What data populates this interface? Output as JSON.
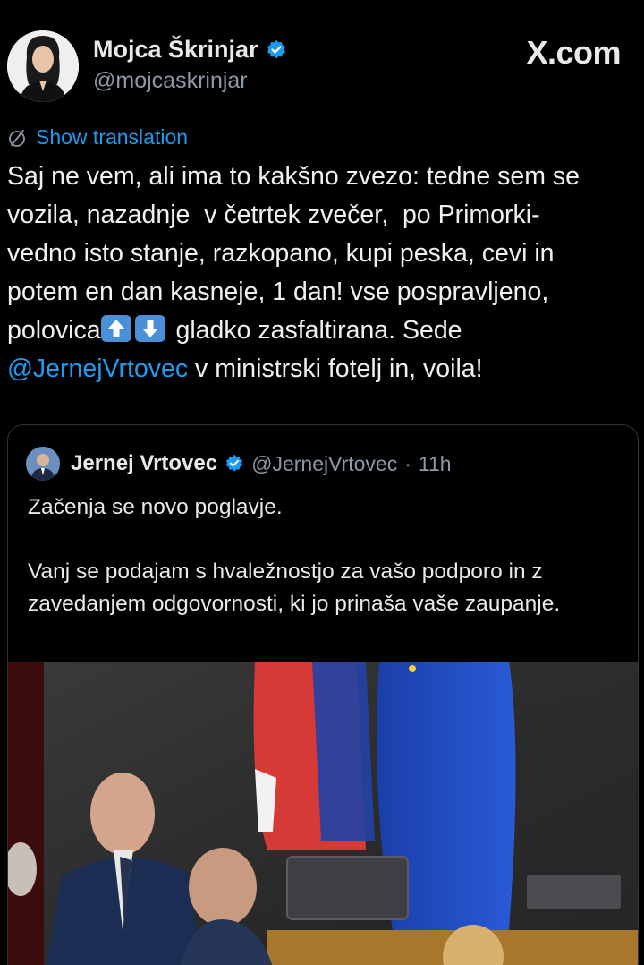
{
  "author": {
    "name": "Mojca Škrinjar",
    "handle": "@mojcaskrinjar",
    "avatar_icon": "profile-photo-woman"
  },
  "brand": {
    "label": "X.com"
  },
  "translation": {
    "label": "Show translation",
    "icon": "translate-icon"
  },
  "tweet": {
    "line1": "Saj ne vem, ali ima to kakšno zvezo: tedne sem se",
    "line2": "vozila, nazadnje  v četrtek zvečer,  po Primorki-",
    "line3": "vedno isto stanje, razkopano, kupi peska, cevi in",
    "line4": "potem en dan kasneje, 1 dan! vse pospravljeno,",
    "line5_pre": "polovica",
    "line5_post": " gladko zasfaltirana. Sede",
    "mention": "@JernejVrtovec",
    "line6_post": " v ministrski fotelj in, voila!",
    "emoji_up": "⬆️",
    "emoji_down": "⬇️"
  },
  "quote": {
    "name": "Jernej Vrtovec",
    "handle": "@JernejVrtovec",
    "separator": "·",
    "time": "11h",
    "text": "Začenja se novo poglavje.\n\nVanj se podajam s hvaležnostjo za vašo podporo in z zavedanjem odgovornosti, ki jo prinaša vaše zaupanje.",
    "media_icon": "video-still-parliament"
  },
  "colors": {
    "accent": "#1d9bf0",
    "background": "#000000",
    "text": "#e7e9ea",
    "muted": "#8b98a5"
  }
}
